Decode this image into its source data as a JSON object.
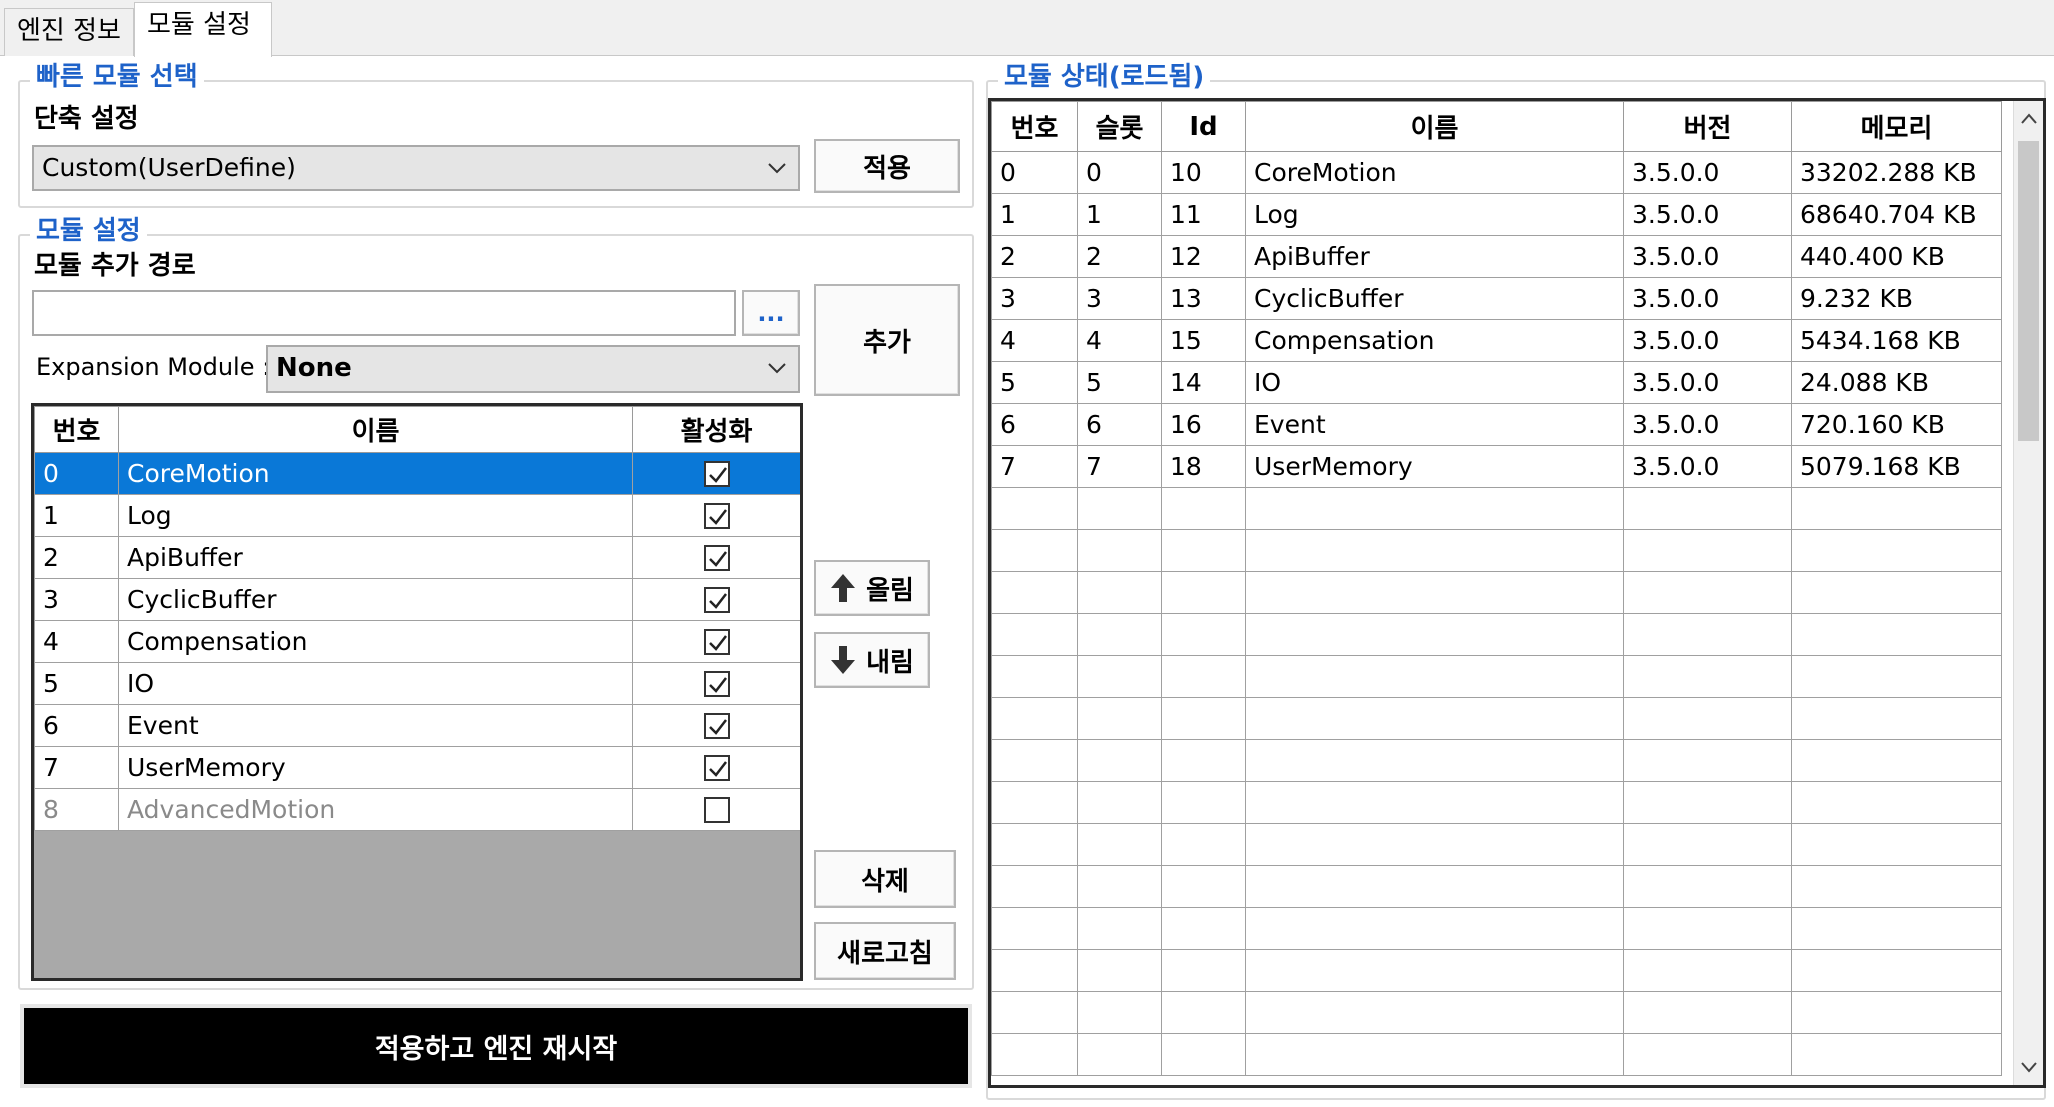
{
  "tabs": [
    {
      "label": "엔진 정보",
      "active": false
    },
    {
      "label": "모듈 설정",
      "active": true
    }
  ],
  "quick_select": {
    "title": "빠른 모듈 선택",
    "label": "단축 설정",
    "selected": "Custom(UserDefine)",
    "apply_button": "적용"
  },
  "module_config": {
    "title": "모듈 설정",
    "path_label": "모듈 추가 경로",
    "path_value": "",
    "browse_button": "...",
    "add_button": "추가",
    "expansion_label": "Expansion Module :",
    "expansion_value": "None",
    "up_button": "올림",
    "down_button": "내림",
    "delete_button": "삭제",
    "refresh_button": "새로고침",
    "columns": [
      "번호",
      "이름",
      "활성화"
    ],
    "rows": [
      {
        "no": "0",
        "name": "CoreMotion",
        "enabled": true,
        "selected": true,
        "disabled": false
      },
      {
        "no": "1",
        "name": "Log",
        "enabled": true,
        "selected": false,
        "disabled": false
      },
      {
        "no": "2",
        "name": "ApiBuffer",
        "enabled": true,
        "selected": false,
        "disabled": false
      },
      {
        "no": "3",
        "name": "CyclicBuffer",
        "enabled": true,
        "selected": false,
        "disabled": false
      },
      {
        "no": "4",
        "name": "Compensation",
        "enabled": true,
        "selected": false,
        "disabled": false
      },
      {
        "no": "5",
        "name": "IO",
        "enabled": true,
        "selected": false,
        "disabled": false
      },
      {
        "no": "6",
        "name": "Event",
        "enabled": true,
        "selected": false,
        "disabled": false
      },
      {
        "no": "7",
        "name": "UserMemory",
        "enabled": true,
        "selected": false,
        "disabled": false
      },
      {
        "no": "8",
        "name": "AdvancedMotion",
        "enabled": false,
        "selected": false,
        "disabled": true
      }
    ]
  },
  "restart_button": "적용하고 엔진 재시작",
  "module_status": {
    "title": "모듈 상태(로드됨)",
    "columns": [
      "번호",
      "슬롯",
      "Id",
      "이름",
      "버전",
      "메모리"
    ],
    "rows": [
      [
        "0",
        "0",
        "10",
        "CoreMotion",
        "3.5.0.0",
        "33202.288 KB"
      ],
      [
        "1",
        "1",
        "11",
        "Log",
        "3.5.0.0",
        "68640.704 KB"
      ],
      [
        "2",
        "2",
        "12",
        "ApiBuffer",
        "3.5.0.0",
        "440.400 KB"
      ],
      [
        "3",
        "3",
        "13",
        "CyclicBuffer",
        "3.5.0.0",
        "9.232 KB"
      ],
      [
        "4",
        "4",
        "15",
        "Compensation",
        "3.5.0.0",
        "5434.168 KB"
      ],
      [
        "5",
        "5",
        "14",
        "IO",
        "3.5.0.0",
        "24.088 KB"
      ],
      [
        "6",
        "6",
        "16",
        "Event",
        "3.5.0.0",
        "720.160 KB"
      ],
      [
        "7",
        "7",
        "18",
        "UserMemory",
        "3.5.0.0",
        "5079.168 KB"
      ]
    ],
    "empty_rows": 14
  },
  "colors": {
    "selection": "#0a78d7",
    "group_title": "#1e62c9"
  }
}
